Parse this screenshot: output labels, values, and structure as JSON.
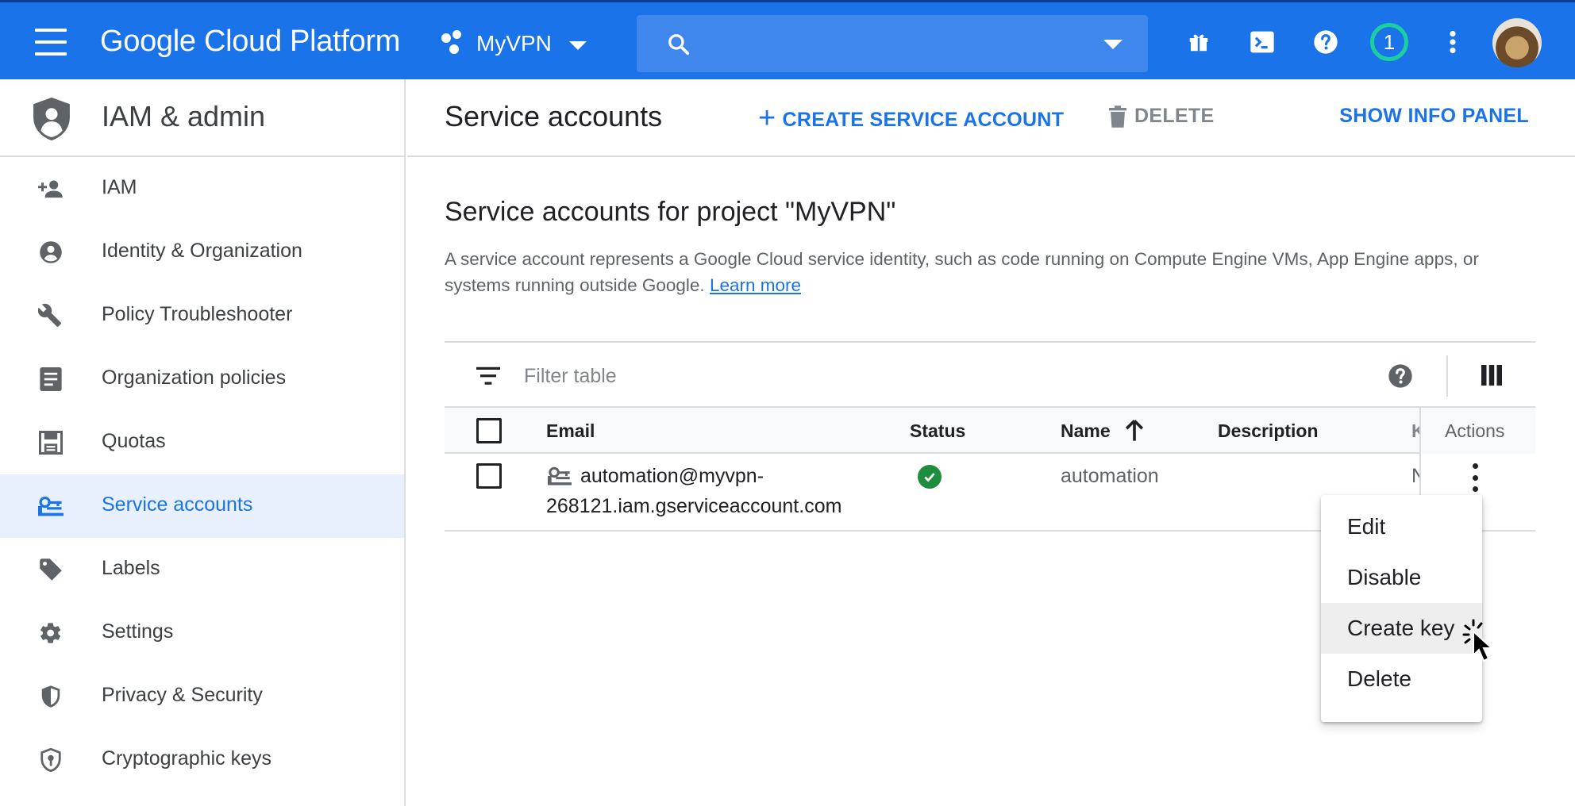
{
  "topbar": {
    "title": "Google Cloud Platform",
    "project_name": "MyVPN",
    "search_placeholder": "",
    "notification_count": "1",
    "icons": [
      "menu-icon",
      "project-dots-icon",
      "search-icon",
      "gift-icon",
      "cloud-shell-icon",
      "help-icon",
      "more-vert-icon",
      "avatar"
    ],
    "bg_color": "#1a73e8"
  },
  "sidebar": {
    "title": "IAM & admin",
    "items": [
      {
        "label": "IAM",
        "icon": "person-add-icon"
      },
      {
        "label": "Identity & Organization",
        "icon": "account-circle-icon"
      },
      {
        "label": "Policy Troubleshooter",
        "icon": "wrench-icon"
      },
      {
        "label": "Organization policies",
        "icon": "document-icon"
      },
      {
        "label": "Quotas",
        "icon": "quota-icon"
      },
      {
        "label": "Service accounts",
        "icon": "service-account-icon",
        "active": true
      },
      {
        "label": "Labels",
        "icon": "label-icon"
      },
      {
        "label": "Settings",
        "icon": "gear-icon"
      },
      {
        "label": "Privacy & Security",
        "icon": "shield-icon"
      },
      {
        "label": "Cryptographic keys",
        "icon": "key-shield-icon"
      }
    ]
  },
  "header": {
    "title": "Service accounts",
    "create_label": "CREATE SERVICE ACCOUNT",
    "delete_label": "DELETE",
    "info_panel_label": "SHOW INFO PANEL"
  },
  "content": {
    "section_title": "Service accounts for project \"MyVPN\"",
    "description": "A service account represents a Google Cloud service identity, such as code running on Compute Engine VMs, App Engine apps, or systems running outside Google.",
    "learn_more": "Learn more"
  },
  "table": {
    "filter_placeholder": "Filter table",
    "columns": [
      "Email",
      "Status",
      "Name",
      "Description",
      "K",
      "Actions"
    ],
    "rows": [
      {
        "email_line1": "automation@myvpn-",
        "email_line2": "268121.iam.gserviceaccount.com",
        "status": "enabled",
        "name": "automation",
        "description": "",
        "key_partial": "N"
      }
    ]
  },
  "actions_menu": {
    "items": [
      "Edit",
      "Disable",
      "Create key",
      "Delete"
    ],
    "hovered": "Create key"
  },
  "colors": {
    "accent": "#1a73e8",
    "status_ok": "#1e8e3e",
    "badge_ring": "#1ccf9f"
  }
}
